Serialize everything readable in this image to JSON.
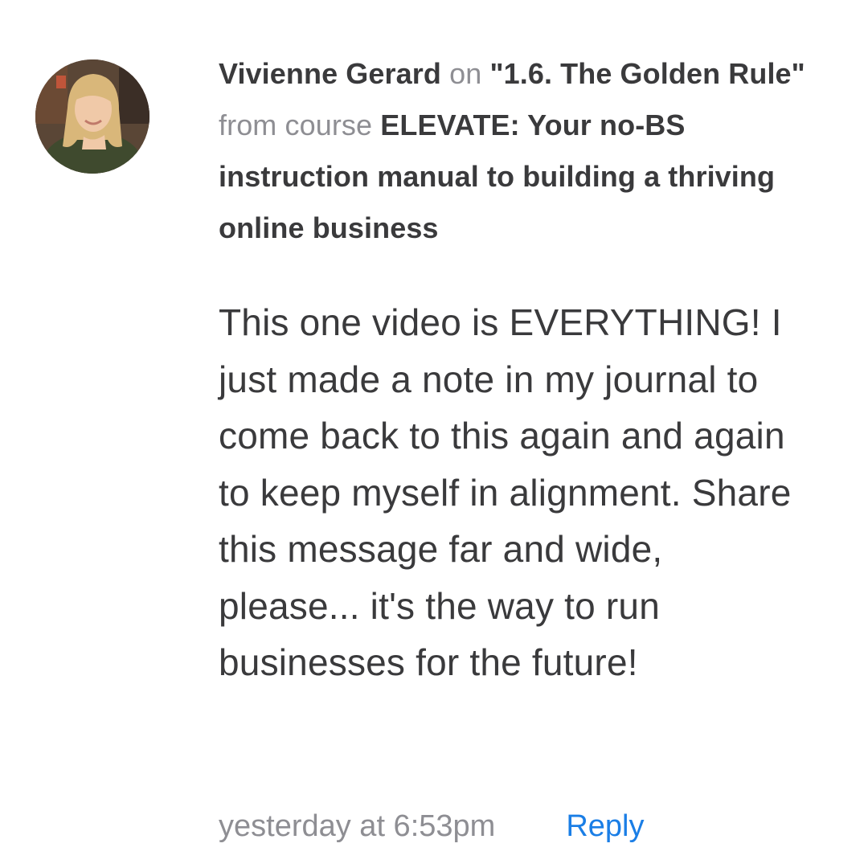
{
  "comment": {
    "author": "Vivienne Gerard",
    "on_label": "on",
    "lesson_title": "\"1.6. The Golden Rule\"",
    "from_label": "from course",
    "course_title": "ELEVATE: Your no-BS instruction manual to building a thriving online business",
    "body": "This one video is EVERYTHING! I just made a note in my journal to come back to this again and again to keep myself in alignment. Share this message far and wide, please... it's the way to run businesses for the future!",
    "timestamp": "yesterday at 6:53pm",
    "reply_label": "Reply"
  },
  "colors": {
    "text": "#3a3a3c",
    "muted": "#8e8e93",
    "link": "#1a7ee6"
  }
}
